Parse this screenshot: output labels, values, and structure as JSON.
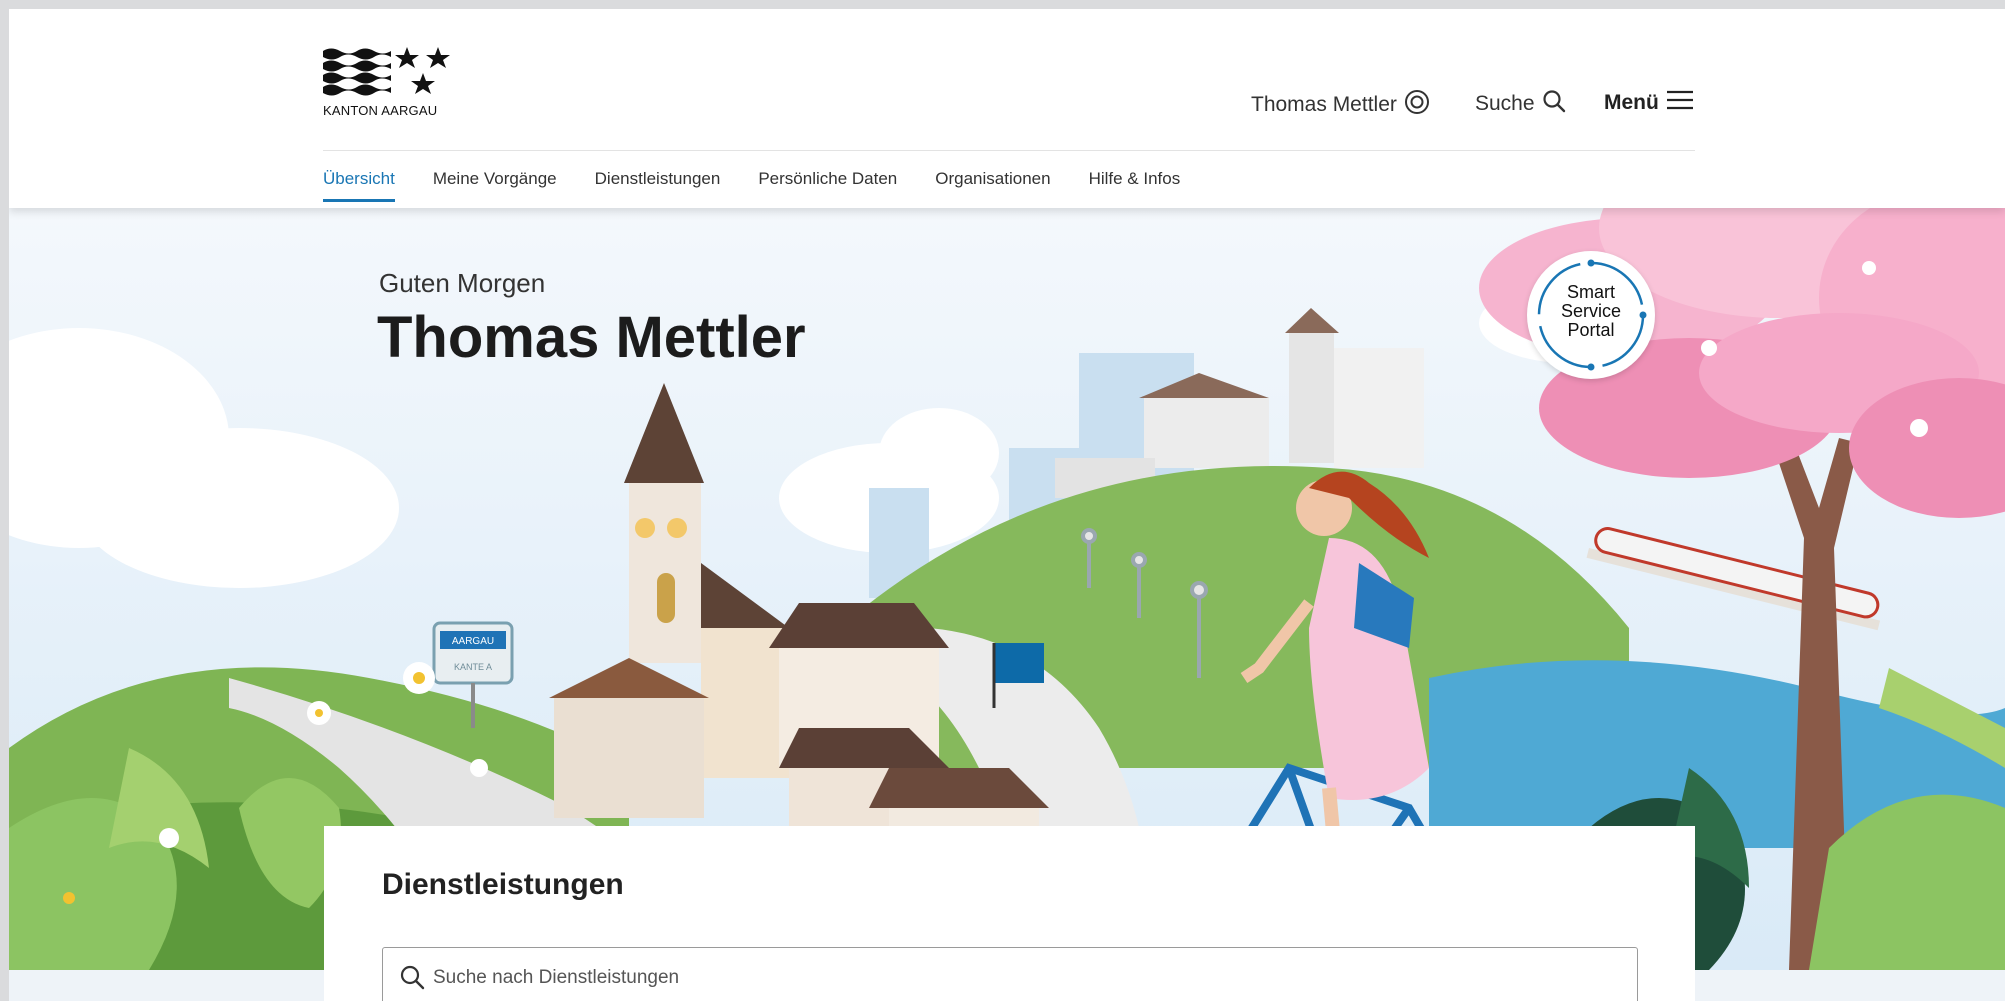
{
  "header": {
    "logo_text": "KANTON AARGAU",
    "user_name": "Thomas Mettler",
    "user_icon": "user-circle-icon",
    "search_label": "Suche",
    "search_icon": "magnifier-icon",
    "menu_label": "Menü",
    "menu_icon": "hamburger-icon"
  },
  "nav": {
    "items": [
      {
        "label": "Übersicht",
        "active": true
      },
      {
        "label": "Meine Vorgänge"
      },
      {
        "label": "Dienstleistungen"
      },
      {
        "label": "Persönliche Daten"
      },
      {
        "label": "Organisationen"
      },
      {
        "label": "Hilfe & Infos"
      }
    ]
  },
  "hero": {
    "greeting": "Guten Morgen",
    "name": "Thomas Mettler",
    "badge": {
      "line1": "Smart",
      "line2": "Service",
      "line3": "Portal"
    },
    "sign_top": "AARGAU",
    "sign_bottom": "KANTE A"
  },
  "services": {
    "title": "Dienstleistungen",
    "search_placeholder": "Suche nach Dienstleistungen"
  },
  "colors": {
    "accent": "#1976b4",
    "hill_green": "#7fb554",
    "blossom_pink": "#f29ac0",
    "sky": "#e6f1fa"
  }
}
